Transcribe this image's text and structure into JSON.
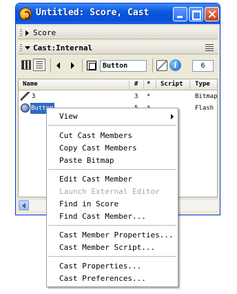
{
  "window": {
    "title": "Untitled: Score, Cast"
  },
  "panels": {
    "score_label": "Score",
    "cast_label": "Cast:Internal"
  },
  "toolbar": {
    "member_name": "Button",
    "member_number": "6"
  },
  "list": {
    "columns": [
      "Name",
      "#",
      "*",
      "Script",
      "Type"
    ],
    "rows": [
      {
        "name": "3",
        "number": "3",
        "star": "*",
        "script": "",
        "type": "Bitmap",
        "icon": "bitmap-icon"
      },
      {
        "name": "Button",
        "number": "5",
        "star": "*",
        "script": "",
        "type": "Flash (",
        "icon": "button-icon"
      }
    ]
  },
  "context_menu": {
    "items": [
      {
        "label": "View",
        "enabled": true,
        "submenu": true
      },
      {
        "label": "Cut Cast Members",
        "enabled": true
      },
      {
        "label": "Copy Cast Members",
        "enabled": true
      },
      {
        "label": "Paste Bitmap",
        "enabled": true
      },
      {
        "label": "Edit Cast Member",
        "enabled": true
      },
      {
        "label": "Launch External Editor",
        "enabled": false
      },
      {
        "label": "Find in Score",
        "enabled": true
      },
      {
        "label": "Find Cast Member...",
        "enabled": true
      },
      {
        "label": "Cast Member Properties...",
        "enabled": true
      },
      {
        "label": "Cast Member Script...",
        "enabled": true
      },
      {
        "label": "Cast Properties...",
        "enabled": true
      },
      {
        "label": "Cast Preferences...",
        "enabled": true
      }
    ]
  },
  "colors": {
    "titlebar": "#0a58e0",
    "selection": "#316ac5",
    "disabled_text": "#a9a9a9"
  }
}
